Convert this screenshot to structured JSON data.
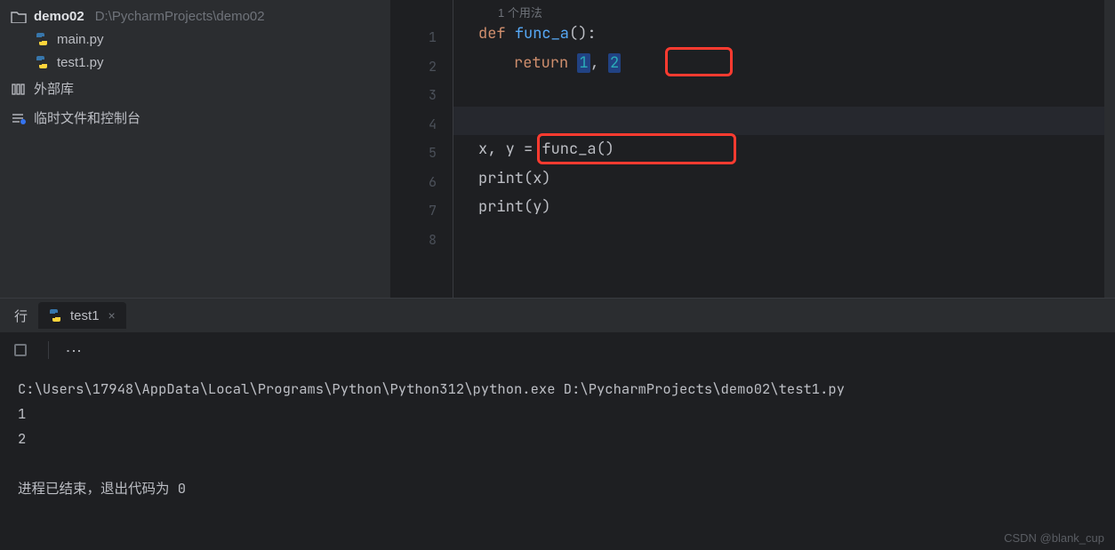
{
  "project": {
    "name": "demo02",
    "path": "D:\\PycharmProjects\\demo02",
    "files": [
      {
        "name": "main.py"
      },
      {
        "name": "test1.py"
      }
    ],
    "external_libs_label": "外部库",
    "scratch_label": "临时文件和控制台"
  },
  "editor": {
    "usage_hint": "1 个用法",
    "line_numbers": [
      "1",
      "2",
      "3",
      "4",
      "5",
      "6",
      "7",
      "8"
    ],
    "code": {
      "l1": {
        "kw": "def ",
        "fn": "func_a",
        "par": "():"
      },
      "l2": {
        "kw": "return ",
        "val1": "1",
        "comma": ", ",
        "val2": "2"
      },
      "l5": {
        "body": "x, y = func_a()"
      },
      "l6": {
        "fn": "print",
        "arg": "(x)"
      },
      "l7": {
        "fn": "print",
        "arg": "(y)"
      }
    }
  },
  "run": {
    "prefix": "行",
    "tab_name": "test1",
    "console_lines": [
      "C:\\Users\\17948\\AppData\\Local\\Programs\\Python\\Python312\\python.exe D:\\PycharmProjects\\demo02\\test1.py ",
      "1",
      "2",
      "",
      "进程已结束，退出代码为 0"
    ]
  },
  "watermark": "CSDN @blank_cup"
}
